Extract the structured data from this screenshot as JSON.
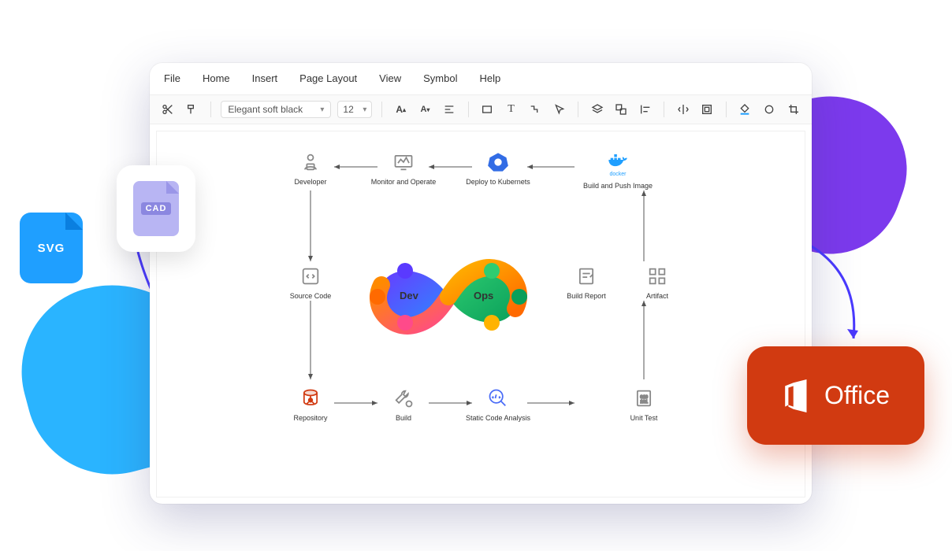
{
  "menu": {
    "file": "File",
    "home": "Home",
    "insert": "Insert",
    "pageLayout": "Page Layout",
    "view": "View",
    "symbol": "Symbol",
    "help": "Help"
  },
  "toolbar": {
    "font": "Elegant soft black",
    "size": "12"
  },
  "badges": {
    "svg": "SVG",
    "cad": "CAD",
    "office": "Office"
  },
  "diagram": {
    "centerLeft": "Dev",
    "centerRight": "Ops",
    "nodes": {
      "developer": "Developer",
      "monitor": "Monitor and Operate",
      "deploy": "Deploy to Kubernets",
      "buildPush": "Build and Push Image",
      "sourceCode": "Source Code",
      "buildReport": "Build Report",
      "artifact": "Artifact",
      "repository": "Repository",
      "build": "Build",
      "sca": "Static Code Analysis",
      "unitTest": "Unit Test"
    },
    "dockerLabel": "docker"
  }
}
